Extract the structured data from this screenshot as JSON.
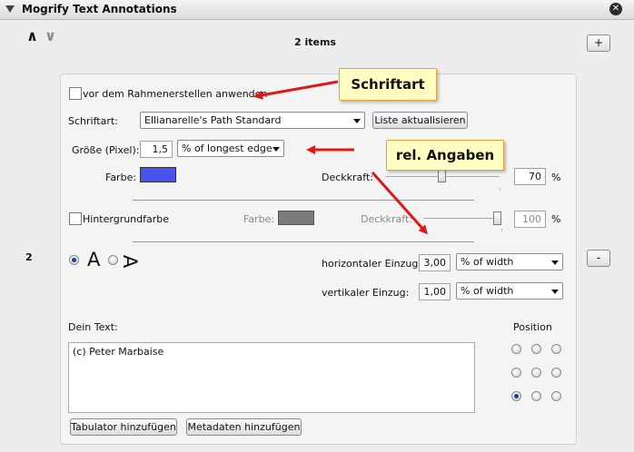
{
  "header": {
    "title": "Mogrify Text Annotations"
  },
  "toolbar": {
    "count": "2 items",
    "add_label": "+",
    "remove_label": "-"
  },
  "item": {
    "number": "2"
  },
  "panel": {
    "apply_before_frame_label": "vor dem Rahmenerstellen anwenden",
    "font_label": "Schriftart:",
    "font_value": "Ellianarelle's Path Standard",
    "refresh_list_label": "Liste aktualisieren",
    "size_label": "Größe (Pixel):",
    "size_value": "1,5",
    "size_unit": "% of longest edge",
    "color_label": "Farbe:",
    "opacity_label": "Deckkraft:",
    "opacity_value": "70",
    "opacity_fraction": 0.7,
    "percent_sign": "%",
    "bg_label": "Hintergrundfarbe",
    "bg_color_label": "Farbe:",
    "bg_opacity_label": "Deckkraft:",
    "bg_opacity_value": "100",
    "bg_opacity_fraction": 1.0,
    "orientation_normal_glyph": "A",
    "orientation_rotated_glyph": "A",
    "h_indent_label": "horizontaler Einzug:",
    "h_indent_value": "3,00",
    "h_indent_unit": "% of width",
    "v_indent_label": "vertikaler Einzug:",
    "v_indent_value": "1,00",
    "v_indent_unit": "% of width",
    "text_label": "Dein Text:",
    "text_value": "(c) Peter Marbaise",
    "position_label": "Position",
    "position_selected": "bottom-left",
    "tab_button_label": "Tabulator hinzufügen",
    "metadata_button_label": "Metadaten hinzufügen"
  },
  "annotations": {
    "font_callout": "Schriftart",
    "relative_callout": "rel. Angaben"
  },
  "colors": {
    "text_color": "#4a52ee",
    "bg_color": "#7b7b7b",
    "arrow": "#e01818",
    "callout_bg": "#ffffc4"
  }
}
